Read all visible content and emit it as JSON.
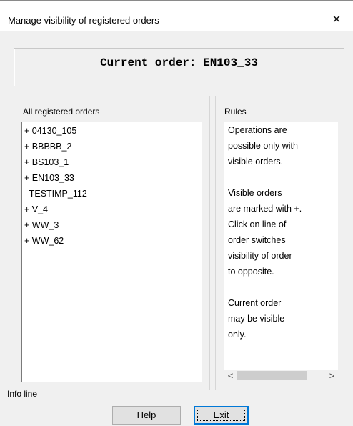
{
  "window": {
    "title": "Manage visibility of registered orders",
    "close_glyph": "✕"
  },
  "current": {
    "text": "Current order: EN103_33"
  },
  "orders": {
    "group_label": "All registered orders",
    "items": [
      "+ 04130_105",
      "+ BBBBB_2",
      "+ BS103_1",
      "+ EN103_33",
      "  TESTIMP_112",
      "+ V_4",
      "+ WW_3",
      "+ WW_62"
    ]
  },
  "rules": {
    "group_label": "Rules",
    "lines": [
      "Operations are",
      "possible only with",
      "visible orders.",
      "",
      "Visible orders",
      "are marked with +.",
      "Click on line of",
      "order switches",
      "visibility of order",
      "to opposite.",
      "",
      "Current order",
      "may be visible",
      "only."
    ],
    "scroll_left": "<",
    "scroll_right": ">"
  },
  "info_line": "Info line",
  "buttons": {
    "help": "Help",
    "exit": "Exit"
  }
}
